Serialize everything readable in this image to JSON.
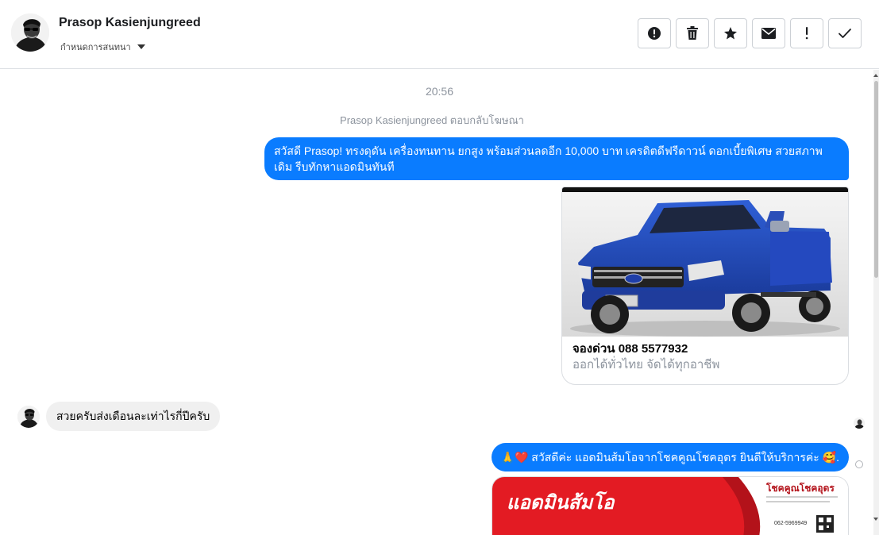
{
  "header": {
    "contact_name": "Prasop Kasienjungreed",
    "assign_label": "กำหนดการสนทนา",
    "icons": [
      "alert-circle-icon",
      "trash-icon",
      "star-icon",
      "envelope-icon",
      "exclamation-icon",
      "check-icon"
    ]
  },
  "thread": {
    "timestamp": "20:56",
    "reply_note": "Prasop Kasienjungreed ตอบกลับโฆษณา",
    "messages": [
      {
        "from": "page",
        "text": "สวัสดี Prasop!  ทรงดุดัน เครื่องทนทาน ยกสูง พร้อมส่วนลดอีก 10,000 บาท เครดิตดีฟรีดาวน์ ดอกเบี้ยพิเศษ สวยสภาพเดิม รีบทักหาแอดมินทันที"
      },
      {
        "from": "page",
        "card": {
          "title": "จองด่วน 088 5577932",
          "subtitle": "ออกได้ทั่วไทย จัดได้ทุกอาชีพ"
        }
      },
      {
        "from": "user",
        "text": "สวยครับส่งเดือนละเท่าไรกี่ปีครับ"
      },
      {
        "from": "page",
        "text": "🙏❤️ สวัสดีค่ะ แอดมินส้มโอจากโชคคูณโชคอุดร ยินดีให้บริการค่ะ  🥰."
      }
    ],
    "promo": {
      "left_text": "แอดมินส้มโอ",
      "brand": "โชคคูณโชคอุดร",
      "phone": "062-5969949"
    }
  },
  "colors": {
    "outgoing_bubble": "#0a7cff",
    "incoming_bubble": "#f0f0f0",
    "promo_red": "#e31b23"
  }
}
